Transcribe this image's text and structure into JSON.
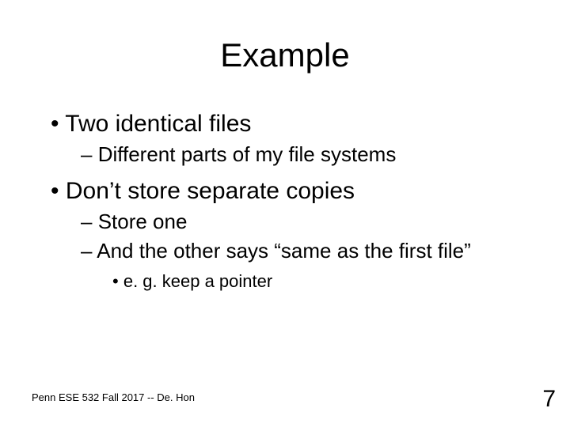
{
  "title": "Example",
  "bullets": {
    "l1a": "Two identical files",
    "l2a": "Different parts of my file systems",
    "l1b": "Don’t store separate copies",
    "l2b": "Store one",
    "l2c": "And the other says “same as the first file”",
    "l3a": "e. g. keep a pointer"
  },
  "footer": "Penn ESE 532 Fall 2017 -- De. Hon",
  "page": "7"
}
